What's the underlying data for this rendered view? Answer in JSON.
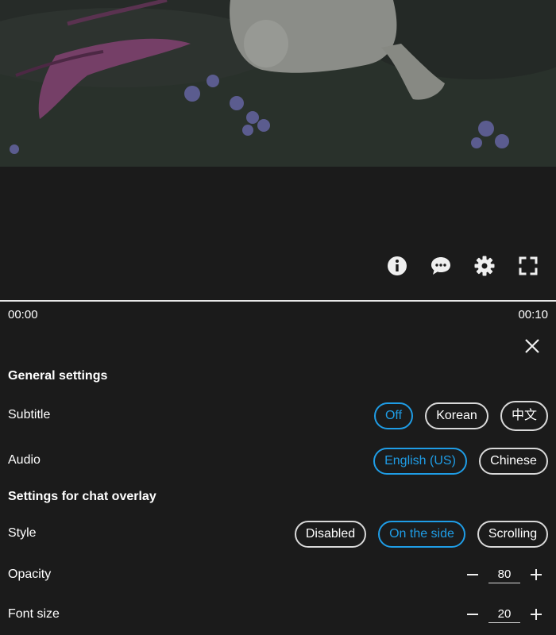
{
  "player": {
    "time_current": "00:00",
    "time_total": "00:10",
    "progress": 0,
    "controls": [
      {
        "icon": "info-icon"
      },
      {
        "icon": "chat-icon"
      },
      {
        "icon": "gear-icon"
      },
      {
        "icon": "fullscreen-icon"
      }
    ]
  },
  "settings": {
    "general_title": "General settings",
    "subtitle": {
      "label": "Subtitle",
      "options": [
        "Off",
        "Korean",
        "中文"
      ],
      "selected": "Off"
    },
    "audio": {
      "label": "Audio",
      "options": [
        "English (US)",
        "Chinese"
      ],
      "selected": "English (US)"
    },
    "chat_title": "Settings for chat overlay",
    "style": {
      "label": "Style",
      "options": [
        "Disabled",
        "On the side",
        "Scrolling"
      ],
      "selected": "On the side"
    },
    "opacity": {
      "label": "Opacity",
      "value": "80"
    },
    "font_size": {
      "label": "Font size",
      "value": "20"
    }
  },
  "colors": {
    "accent": "#1f9de6",
    "background": "#1b1b1b"
  }
}
